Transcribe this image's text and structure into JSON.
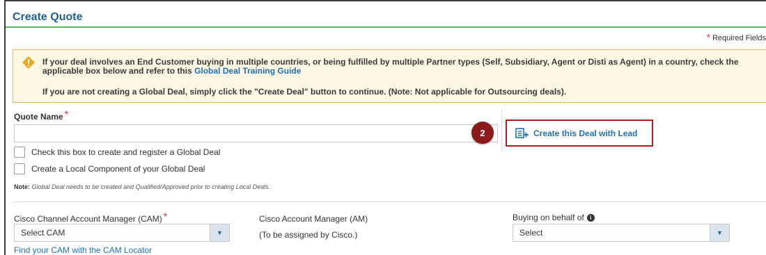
{
  "page": {
    "title": "Create Quote"
  },
  "required": {
    "star": "*",
    "text": "Required Fields"
  },
  "alert": {
    "icon": "warning-diamond-icon",
    "line1": "If your deal involves an End Customer buying in multiple countries, or being fulfilled by multiple Partner types (Self, Subsidiary, Agent or Disti as Agent) in a country, check the applicable box below and refer to this",
    "link": "Global Deal Training Guide",
    "line2": "If you are not creating a Global Deal, simply click the \"Create Deal\" button to continue. (Note: Not applicable for Outsourcing deals)."
  },
  "quote_name": {
    "label": "Quote Name",
    "star": "*",
    "value": ""
  },
  "step_badge": "2",
  "create_lead": {
    "label": "Create this Deal with Lead",
    "icon": "create-deal-icon"
  },
  "checkboxes": [
    {
      "label": "Check this box to create and register a Global Deal",
      "checked": false
    },
    {
      "label": "Create a Local Component of your Global Deal",
      "checked": false
    }
  ],
  "note": {
    "prefix": "Note:",
    "text": "Global Deal needs to be created and Qualified/Approved prior to creating Local Deals."
  },
  "cam": {
    "label": "Cisco Channel Account Manager (CAM)",
    "star": "*",
    "selected": "Select CAM",
    "locator_link": "Find your CAM with the CAM Locator"
  },
  "am": {
    "label": "Cisco Account Manager (AM)",
    "value": "(To be assigned by Cisco.)"
  },
  "behalf": {
    "label": "Buying on behalf of",
    "info_icon": "info-icon",
    "selected": "Select"
  },
  "colors": {
    "title": "#1f5f9a",
    "link": "#1f6fb5",
    "accent_line": "#5cb85c",
    "alert_bg": "#fcf8e3",
    "alert_border": "#f0b35c",
    "badge": "#8b1a1a",
    "highlight_border": "#b51d1d",
    "required": "#d9232d"
  }
}
